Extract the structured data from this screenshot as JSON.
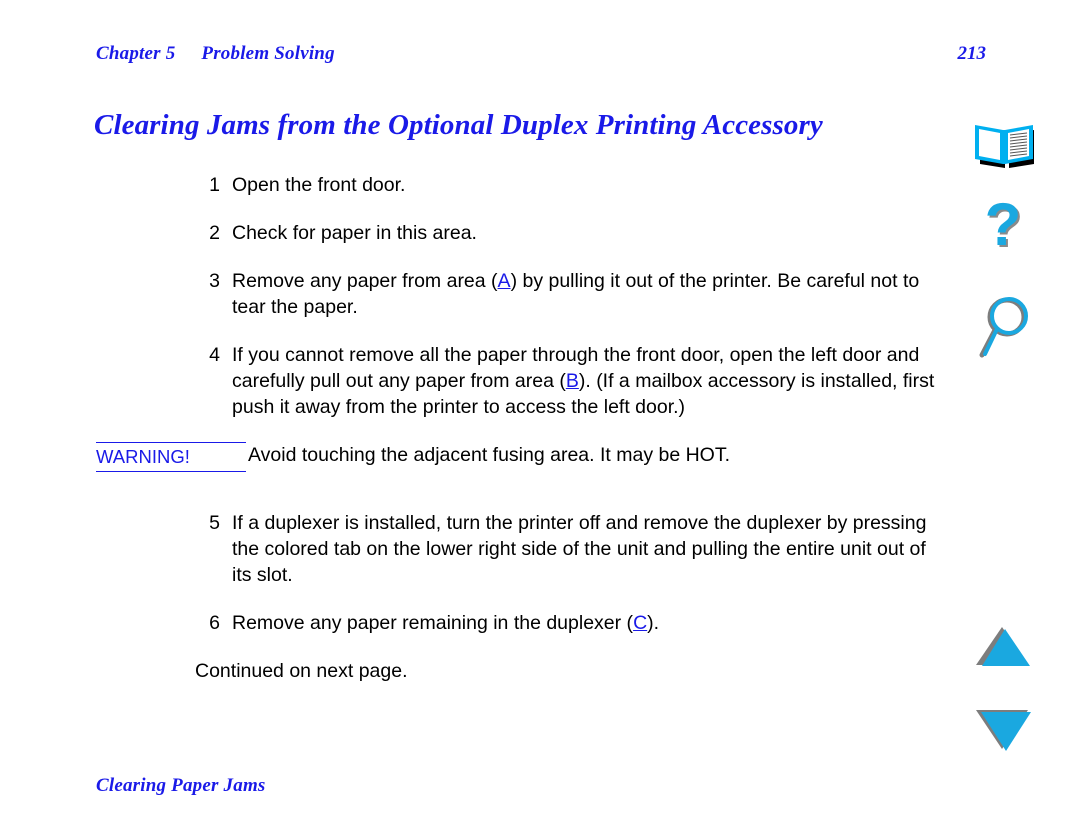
{
  "header": {
    "chapter_label": "Chapter 5",
    "chapter_topic": "Problem Solving",
    "page_number": "213"
  },
  "title": "Clearing Jams from the Optional Duplex Printing Accessory",
  "steps": [
    {
      "number": "1",
      "text": "Open the front door."
    },
    {
      "number": "2",
      "text": "Check for paper in this area."
    },
    {
      "number": "3",
      "text_before": "Remove any paper from area (",
      "xref": "A",
      "text_after": ") by pulling it out of the printer. Be careful not to tear the paper."
    },
    {
      "number": "4",
      "text_before": "If you cannot remove all the paper through the front door, open the left door and carefully pull out any paper from area (",
      "xref": "B",
      "text_after": "). (If a mailbox accessory is installed, first push it away from the printer to access the left door.)"
    },
    {
      "number": "5",
      "text": "If a duplexer is installed, turn the printer off and remove the duplexer by pressing the colored tab on the lower right side of the unit and pulling the entire unit out of its slot."
    },
    {
      "number": "6",
      "text_before": "Remove any paper remaining in the duplexer (",
      "xref": "C",
      "text_after": ")."
    }
  ],
  "warning": {
    "label": "WARNING!",
    "text": "Avoid touching the adjacent fusing area. It may be HOT."
  },
  "continued": "Continued on next page.",
  "footer": {
    "section": "Clearing Paper Jams"
  },
  "nav": {
    "book_icon": "open-book-icon",
    "help_icon": "question-mark-icon",
    "search_icon": "magnifier-icon",
    "up_icon": "triangle-up-icon",
    "down_icon": "triangle-down-icon"
  },
  "colors": {
    "link_blue": "#1a1ae8",
    "icon_cyan": "#1aa8e0",
    "icon_shadow": "#7a7a7a",
    "text_black": "#000000",
    "page_background": "#ffffff"
  }
}
